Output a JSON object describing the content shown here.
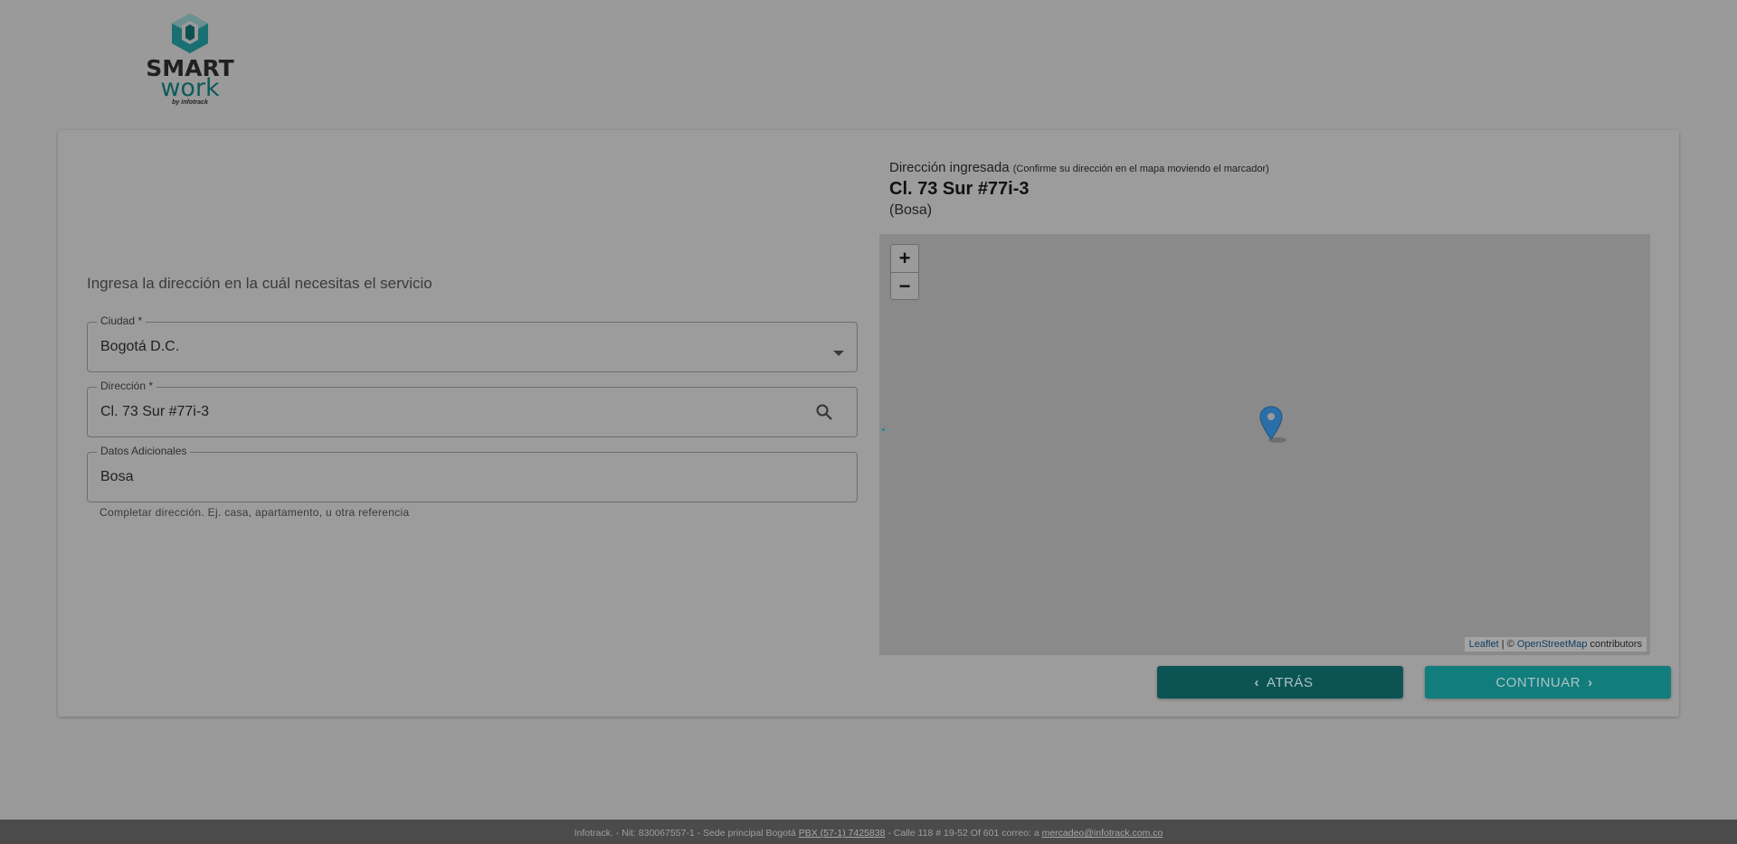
{
  "brand": {
    "line1": "SMART",
    "line2": "work",
    "by": "by infotrack"
  },
  "form": {
    "prompt": "Ingresa la dirección en la cuál necesitas el servicio",
    "city": {
      "label": "Ciudad *",
      "value": "Bogotá D.C."
    },
    "address": {
      "label": "Dirección *",
      "value": "Cl. 73 Sur #77i-3"
    },
    "extra": {
      "label": "Datos Adicionales",
      "value": "Bosa"
    },
    "hint": "Completar dirección. Ej. casa, apartamento, u otra referencia"
  },
  "entered": {
    "title": "Dirección ingresada",
    "note": "(Confirme su dirección en el mapa moviendo el marcador)",
    "address": "Cl. 73 Sur #77i-3",
    "extra": "(Bosa)"
  },
  "map": {
    "zoom_in": "+",
    "zoom_out": "−",
    "attribution_leaflet": "Leaflet",
    "attribution_sep": " | © ",
    "attribution_osm": "OpenStreetMap",
    "attribution_tail": " contributors"
  },
  "buttons": {
    "back": "ATRÁS",
    "next": "CONTINUAR"
  },
  "footer": {
    "company": "Infotrack. - Nit: 830067557-1 - Sede principal Bogotá",
    "phone": "PBX (57-1) 7425838",
    "address": " - Calle 118 # 19-52 Of 601   correo: a ",
    "email": "mercadeo@infotrack.com.co"
  },
  "colors": {
    "teal_dark": "#0c5454",
    "teal": "#127d7d",
    "marker": "#2a6fa8"
  }
}
